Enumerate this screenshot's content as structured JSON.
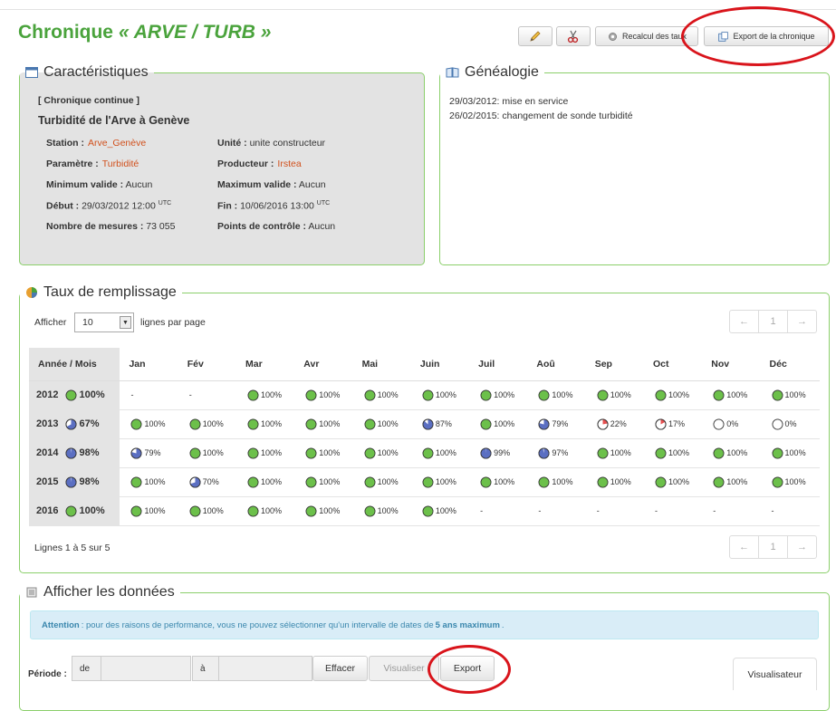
{
  "title": {
    "prefix": "Chronique",
    "name": "« ARVE / TURB »"
  },
  "toolbar": {
    "recalc_label": "Recalcul des taux",
    "export_label": "Export de la chronique"
  },
  "characteristics": {
    "legend": "Caractéristiques",
    "kind": "[ Chronique continue ]",
    "heading": "Turbidité de l'Arve à Genève",
    "station_label": "Station :",
    "station_value": "Arve_Genève",
    "unit_label": "Unité :",
    "unit_value": "unite constructeur",
    "param_label": "Paramètre :",
    "param_value": "Turbidité",
    "producer_label": "Producteur :",
    "producer_value": "Irstea",
    "min_label": "Minimum valide :",
    "min_value": "Aucun",
    "max_label": "Maximum valide :",
    "max_value": "Aucun",
    "start_label": "Début :",
    "start_value": "29/03/2012 12:00",
    "end_label": "Fin :",
    "end_value": "10/06/2016 13:00",
    "utc": "UTC",
    "count_label": "Nombre de mesures :",
    "count_value": "73 055",
    "control_label": "Points de contrôle :",
    "control_value": "Aucun"
  },
  "genealogy": {
    "legend": "Généalogie",
    "entries": [
      "29/03/2012: mise en service",
      "26/02/2015: changement de sonde turbidité"
    ]
  },
  "fill": {
    "legend": "Taux de remplissage",
    "show_label": "Afficher",
    "show_value": "10",
    "per_page": "lignes par page",
    "pager": {
      "prev": "←",
      "page": "1",
      "next": "→"
    },
    "header": [
      "Année / Mois",
      "Jan",
      "Fév",
      "Mar",
      "Avr",
      "Mai",
      "Juin",
      "Juil",
      "Aoû",
      "Sep",
      "Oct",
      "Nov",
      "Déc"
    ],
    "rows": [
      {
        "year": "2012",
        "year_pct": 100,
        "months": [
          null,
          null,
          100,
          100,
          100,
          100,
          100,
          100,
          100,
          100,
          100,
          100
        ]
      },
      {
        "year": "2013",
        "year_pct": 67,
        "months": [
          100,
          100,
          100,
          100,
          100,
          87,
          100,
          79,
          22,
          17,
          0,
          0
        ]
      },
      {
        "year": "2014",
        "year_pct": 98,
        "months": [
          79,
          100,
          100,
          100,
          100,
          100,
          99,
          97,
          100,
          100,
          100,
          100
        ]
      },
      {
        "year": "2015",
        "year_pct": 98,
        "months": [
          100,
          70,
          100,
          100,
          100,
          100,
          100,
          100,
          100,
          100,
          100,
          100
        ]
      },
      {
        "year": "2016",
        "year_pct": 100,
        "months": [
          100,
          100,
          100,
          100,
          100,
          100,
          null,
          null,
          null,
          null,
          null,
          null
        ]
      }
    ],
    "empty_cell": "-",
    "summary": "Lignes 1 à 5 sur 5",
    "colors": {
      "full": "#6cc04a",
      "partial": "#5b6fc2",
      "low": "#e64f4f"
    }
  },
  "data_section": {
    "legend": "Afficher les données",
    "alert_strong": "Attention",
    "alert_text": " : pour des raisons de performance, vous ne pouvez sélectionner qu'un intervalle de dates de ",
    "alert_emph": "5 ans maximum",
    "alert_end": ".",
    "period_label": "Période :",
    "from_label": "de",
    "to_label": "à",
    "clear_label": "Effacer",
    "view_label": "Visualiser",
    "export_label": "Export",
    "tab_label": "Visualisateur"
  }
}
